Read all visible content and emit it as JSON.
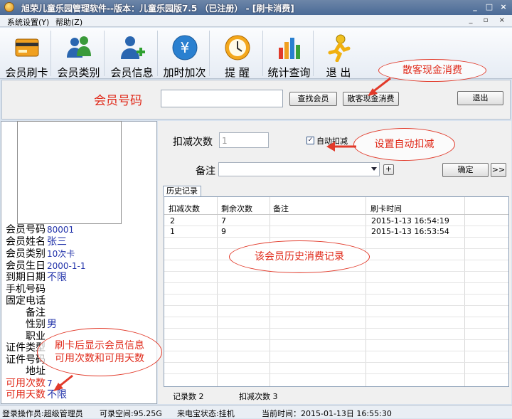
{
  "window": {
    "title": "旭荣儿童乐园管理软件--版本：儿童乐园版7.5 （已注册） - [刷卡消费]",
    "buttons": [
      "_",
      "□",
      "×"
    ]
  },
  "menu": {
    "items": [
      "系统设置(Y)",
      "帮助(Z)"
    ],
    "mdi": "_ ▫ ×"
  },
  "toolbar": {
    "items": [
      {
        "label": "会员刷卡",
        "icon": "card-icon"
      },
      {
        "label": "会员类别",
        "icon": "users-icon"
      },
      {
        "label": "会员信息",
        "icon": "user-add-icon"
      },
      {
        "label": "加时加次",
        "icon": "yen-icon"
      },
      {
        "label": "提 醒",
        "icon": "clock-icon"
      },
      {
        "label": "统计查询",
        "icon": "bar-chart-icon"
      },
      {
        "label": "退 出",
        "icon": "exit-runner-icon"
      }
    ]
  },
  "search": {
    "label": "会员号码",
    "value": "",
    "find_button": "查找会员",
    "cash_button": "散客现金消费",
    "exit_button": "退出"
  },
  "member": {
    "fields": [
      {
        "key": "会员号码",
        "value": "80001"
      },
      {
        "key": "会员姓名",
        "value": "张三"
      },
      {
        "key": "会员类别",
        "value": "10次卡"
      },
      {
        "key": "会员生日",
        "value": "2000-1-1"
      },
      {
        "key": "到期日期",
        "value": "不限"
      },
      {
        "key": "手机号码",
        "value": ""
      },
      {
        "key": "固定电话",
        "value": ""
      },
      {
        "key": "备注",
        "value": ""
      },
      {
        "key": "性别",
        "value": "男"
      },
      {
        "key": "职业",
        "value": ""
      },
      {
        "key": "证件类型",
        "value": ""
      },
      {
        "key": "证件号码",
        "value": ""
      },
      {
        "key": "地址",
        "value": ""
      },
      {
        "key": "可用次数",
        "value": "7"
      },
      {
        "key": "可用天数",
        "value": "不限"
      }
    ]
  },
  "deduct": {
    "label": "扣减次数",
    "placeholder": "1",
    "auto_label": "自动扣减",
    "auto_checked": true,
    "note_label": "备注",
    "plus": "+",
    "ok_button": "确定",
    "more_button": ">>"
  },
  "history": {
    "tab": "历史记录",
    "columns": [
      "扣减次数",
      "剩余次数",
      "备注",
      "刷卡时间"
    ],
    "rows": [
      [
        "2",
        "7",
        "",
        "2015-1-13 16:54:19"
      ],
      [
        "1",
        "9",
        "",
        "2015-1-13 16:53:54"
      ]
    ],
    "summary_count": "记录数 2",
    "summary_deduct": "扣减次数 3"
  },
  "status": {
    "operator": "登录操作员:超级管理员",
    "space": "可录空间:95.25G",
    "stall": "来电宝状态:挂机",
    "time": "当前时间：2015-01-13日 16:55:30"
  },
  "annotations": {
    "cash": "散客现金消费",
    "auto": "设置自动扣减",
    "history": "该会员历史消费记录",
    "info": "刷卡后显示会员信息\n可用次数和可用天数"
  },
  "colors": {
    "accent_red": "#e02a1a",
    "value_blue": "#2233aa"
  }
}
